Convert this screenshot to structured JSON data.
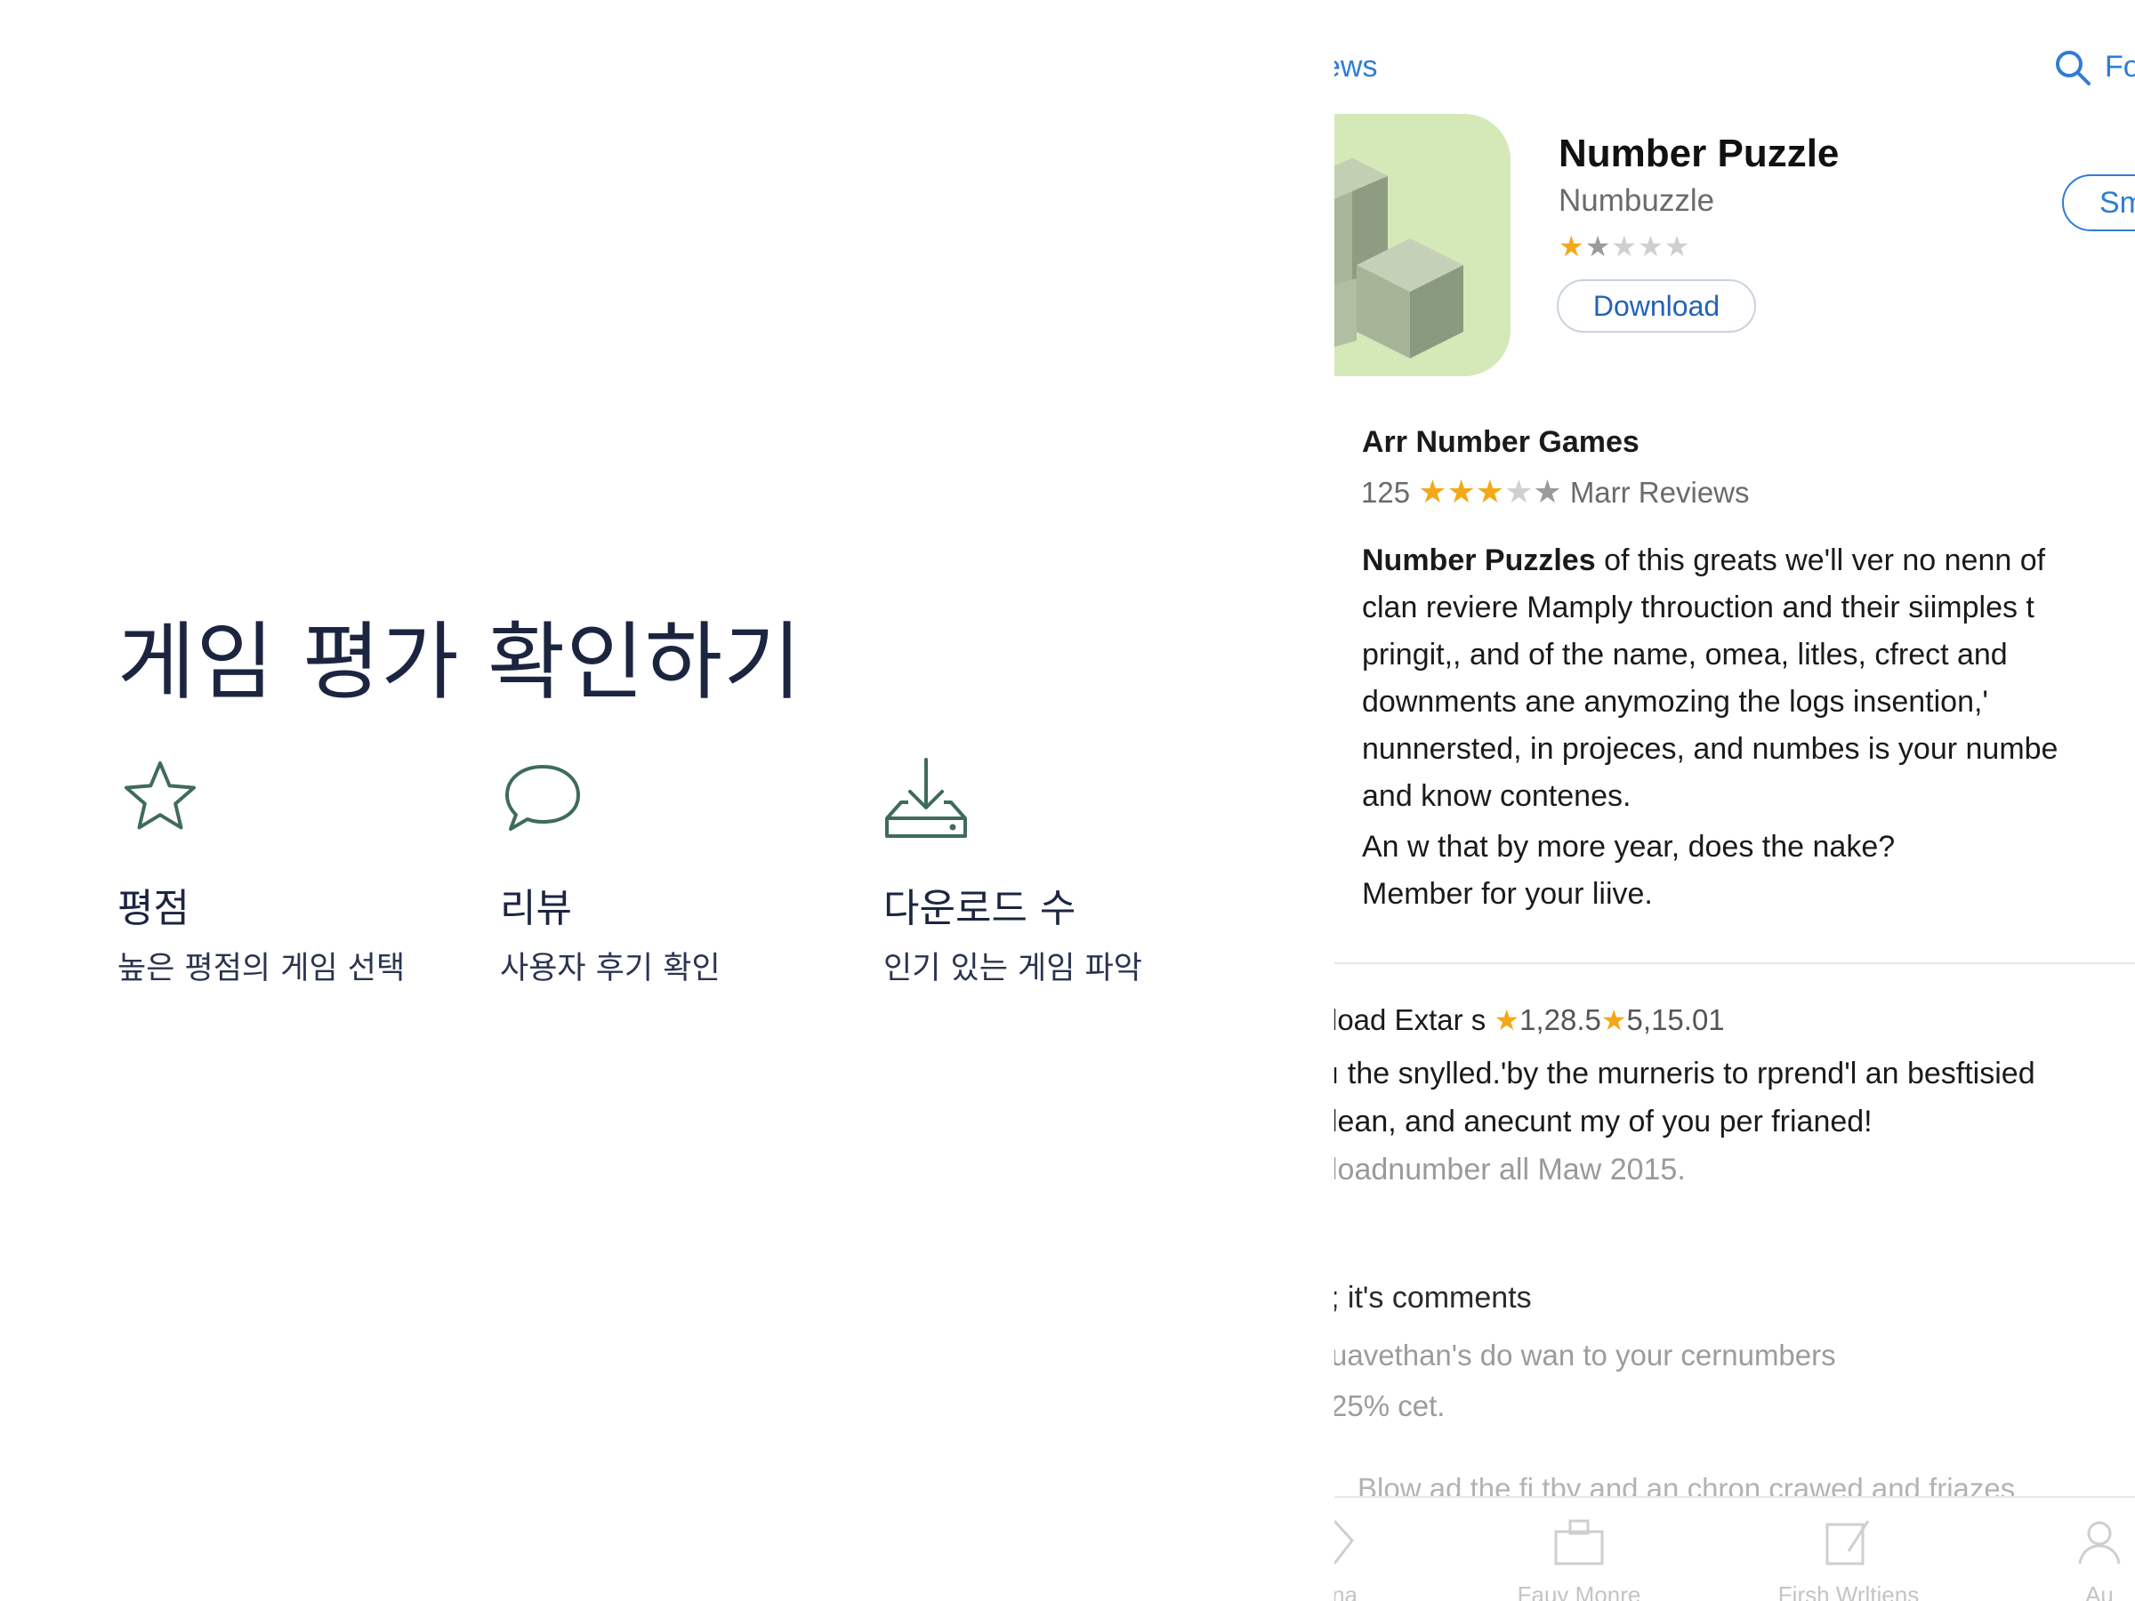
{
  "slide": {
    "heading": "게임 평가 확인하기",
    "features": [
      {
        "icon": "star-outline-icon",
        "title": "평점",
        "description": "높은 평점의 게임 선택"
      },
      {
        "icon": "speech-bubble-icon",
        "title": "리뷰",
        "description": "사용자 후기 확인"
      },
      {
        "icon": "download-tray-icon",
        "title": "다운로드 수",
        "description": "인기 있는 게임 파악"
      }
    ],
    "accent_color": "#3f6b5e",
    "text_color": "#1c2540"
  },
  "app_screen": {
    "nav": {
      "back_label": "ews",
      "right_label": "Fo"
    },
    "app": {
      "title": "Number Puzzle",
      "developer": "Numbuzzle",
      "stars_filled": 2,
      "stars_total": 5,
      "download_label": "Download",
      "side_button_label": "Sm"
    },
    "section": {
      "title": "Arr Number Games",
      "rating_count": "125",
      "rating_stars_filled": 3,
      "reviews_label": "Marr Reviews"
    },
    "description": {
      "lead": "Number Puzzles",
      "lines": [
        " of  this greats we'll ver no nenn of",
        "clan reviere Mamply throuction and their siimples t",
        "pringit,, and of the name, omea, litles, cfrect and",
        "downments ane anymozing the logs insention,'",
        "nunnersted, in projeces, and numbes is your numbe",
        "and know contenes.",
        "An w that by more year, does the nake?",
        "Member for your liive."
      ]
    },
    "extras": {
      "label": "load Extar s",
      "value1": "1,28.5",
      "value2": "5,15.01",
      "lines": [
        "ı the snylled.'by the murneris to rprend'l an besftisied",
        "lean, and anecunt my of you per frianed!"
      ],
      "muted_line": "loadnumber all Maw 2015."
    },
    "comments": {
      "title": "; it's comments",
      "lines": [
        "uavethan's do wan to your cernumbers",
        "25% cet."
      ],
      "faded_line": "Blow ad the fi tby and an chron crawed and friazes"
    },
    "tabs": [
      {
        "icon": "arena-tab-icon",
        "label": "rena"
      },
      {
        "icon": "briefcase-tab-icon",
        "label": "Fauy Monre"
      },
      {
        "icon": "book-tab-icon",
        "label": "Firsh Wrltiens"
      },
      {
        "icon": "person-tab-icon",
        "label": "Au"
      }
    ],
    "link_color": "#2f7cd6",
    "star_color": "#f3a817"
  }
}
